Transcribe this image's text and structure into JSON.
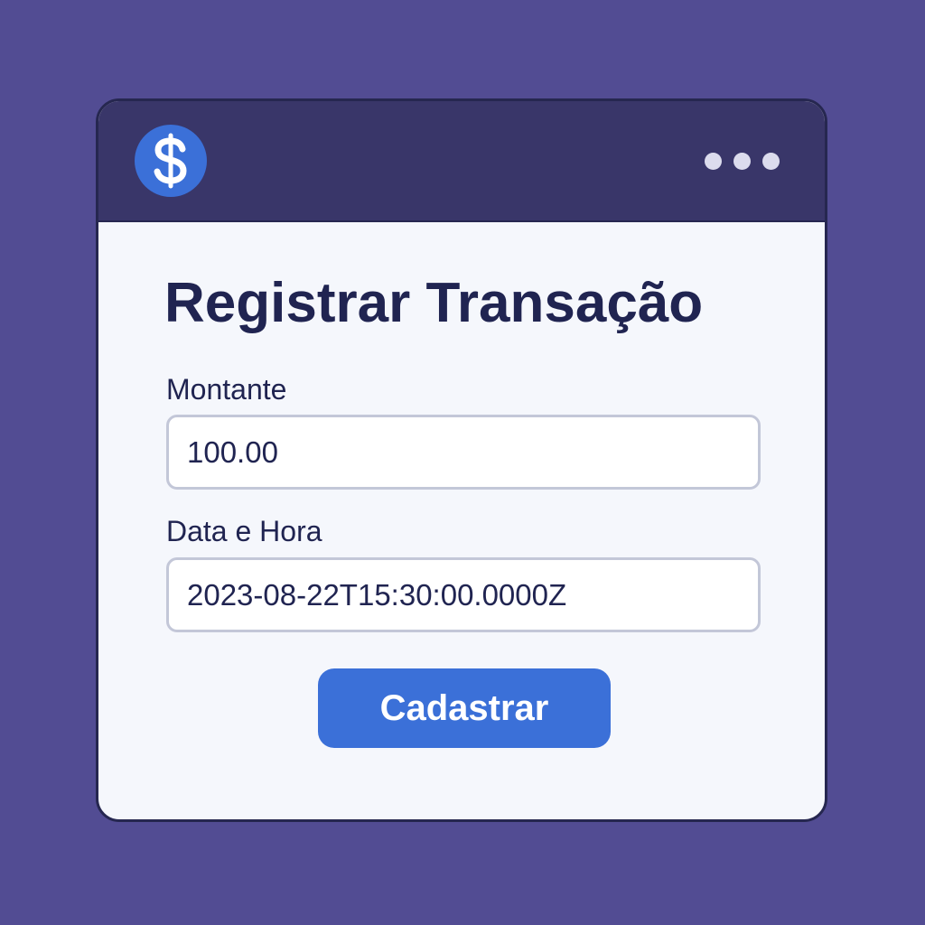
{
  "colors": {
    "background": "#524c93",
    "titlebar": "#393669",
    "accent": "#3b70d8",
    "text": "#202451"
  },
  "titlebar": {
    "logo_icon": "dollar-sign-icon",
    "menu_icon": "more-horizontal-icon"
  },
  "form": {
    "title": "Registrar Transação",
    "amount": {
      "label": "Montante",
      "value": "100.00"
    },
    "datetime": {
      "label": "Data e Hora",
      "value": "2023-08-22T15:30:00.0000Z"
    },
    "submit_label": "Cadastrar"
  }
}
